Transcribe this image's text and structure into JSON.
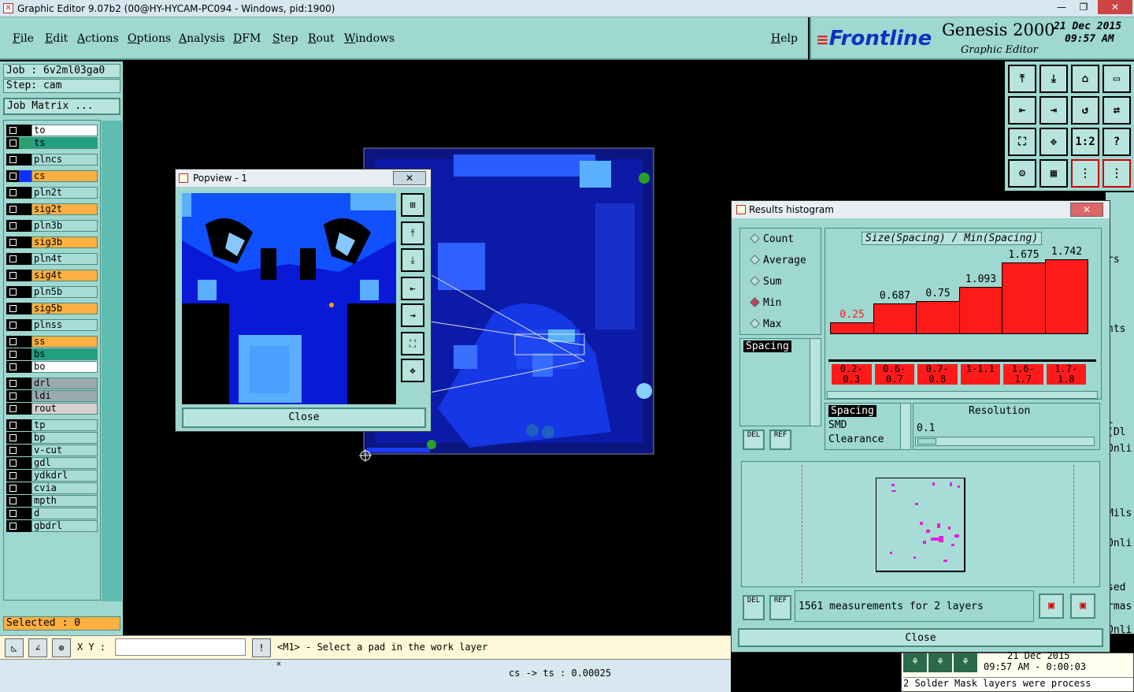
{
  "window": {
    "title": "Graphic Editor 9.07b2 (00@HY-HYCAM-PC094 - Windows, pid:1900)",
    "minimize": "—",
    "restore": "❐",
    "close": "✕"
  },
  "menu": {
    "items": [
      "File",
      "Edit",
      "Actions",
      "Options",
      "Analysis",
      "DFM",
      "Step",
      "Rout",
      "Windows"
    ],
    "help": "Help"
  },
  "brand": {
    "logo": "Frontline",
    "product": "Genesis 2000",
    "subtitle": "Graphic Editor",
    "date": "21 Dec 2015",
    "time": "09:57 AM"
  },
  "left": {
    "job": "Job : 6v2ml03ga0",
    "step": "Step: cam",
    "job_matrix": "Job Matrix ...",
    "selected": "Selected : 0",
    "layers": [
      {
        "name": "to",
        "color": "#000000",
        "bg": "#ffffff"
      },
      {
        "name": "ts",
        "color": "#2aa070",
        "bg": "#20a080",
        "active": true
      },
      {
        "name": "plncs",
        "color": "#000000",
        "bg": "#a8dcd6"
      },
      {
        "name": "cs",
        "color": "#1030ff",
        "bg": "#ffb040"
      },
      {
        "name": "pln2t",
        "color": "#000000",
        "bg": "#a8dcd6"
      },
      {
        "name": "sig2t",
        "color": "#000000",
        "bg": "#ffb040"
      },
      {
        "name": "pln3b",
        "color": "#000000",
        "bg": "#a8dcd6"
      },
      {
        "name": "sig3b",
        "color": "#000000",
        "bg": "#ffb040"
      },
      {
        "name": "pln4t",
        "color": "#000000",
        "bg": "#a8dcd6"
      },
      {
        "name": "sig4t",
        "color": "#000000",
        "bg": "#ffb040"
      },
      {
        "name": "pln5b",
        "color": "#000000",
        "bg": "#a8dcd6"
      },
      {
        "name": "sig5b",
        "color": "#000000",
        "bg": "#ffb040"
      },
      {
        "name": "plnss",
        "color": "#000000",
        "bg": "#a8dcd6"
      },
      {
        "name": "ss",
        "color": "#000000",
        "bg": "#ffb040"
      },
      {
        "name": "bs",
        "color": "#000000",
        "bg": "#20a080"
      },
      {
        "name": "bo",
        "color": "#000000",
        "bg": "#ffffff"
      },
      {
        "name": "drl",
        "color": "#000000",
        "bg": "#9aaab0"
      },
      {
        "name": "ldi",
        "color": "#000000",
        "bg": "#9aaab0"
      },
      {
        "name": "rout",
        "color": "#000000",
        "bg": "#d8d0d0"
      },
      {
        "name": "tp",
        "color": "#000000",
        "bg": "#a8dcd6"
      },
      {
        "name": "bp",
        "color": "#000000",
        "bg": "#a8dcd6"
      },
      {
        "name": "v-cut",
        "color": "#000000",
        "bg": "#a8dcd6"
      },
      {
        "name": "gdl",
        "color": "#000000",
        "bg": "#a8dcd6"
      },
      {
        "name": "ydkdrl",
        "color": "#000000",
        "bg": "#a8dcd6"
      },
      {
        "name": "cvia",
        "color": "#000000",
        "bg": "#a8dcd6"
      },
      {
        "name": "mpth",
        "color": "#000000",
        "bg": "#a8dcd6"
      },
      {
        "name": "d",
        "color": "#000000",
        "bg": "#a8dcd6"
      },
      {
        "name": "gbdrl",
        "color": "#000000",
        "bg": "#a8dcd6"
      }
    ]
  },
  "popview": {
    "title": "Popview - 1",
    "close": "Close",
    "close_x": "✕"
  },
  "histogram": {
    "title": "Results histogram",
    "close_x": "✕",
    "options": [
      "Count",
      "Average",
      "Sum",
      "Min",
      "Max"
    ],
    "selected_option": "Min",
    "chart_title": "Size(Spacing) / Min(Spacing)",
    "list_left": [
      "Spacing"
    ],
    "categories_list": [
      "Spacing",
      "SMD",
      "Clearance"
    ],
    "resolution_label": "Resolution",
    "resolution_value": "0.1",
    "del": "DEL",
    "ref": "REF",
    "measurements": "1561 measurements for 2 layers",
    "close": "Close"
  },
  "chart_data": {
    "type": "bar",
    "title": "Size(Spacing) / Min(Spacing)",
    "categories": [
      "0.2-0.3",
      "0.6-0.7",
      "0.7-0.8",
      "1-1.1",
      "1.6-1.7",
      "1.7-1.8"
    ],
    "values": [
      0.25,
      0.687,
      0.75,
      1.093,
      1.675,
      1.742
    ],
    "ylim": [
      0,
      1.8
    ],
    "colors": {
      "bar": "#ff1a1a",
      "first_label": "#ff1a1a"
    }
  },
  "status": {
    "xy_label": "X Y :",
    "prompt": "<M1> - Select a pad in the work layer",
    "value": "cs -> ts : 0.00025"
  },
  "bottom_right": {
    "date": "21 Dec 2015",
    "time": "09:57 AM - 0:00:03",
    "message": "2 Solder Mask layers were process"
  },
  "behind": {
    "items": [
      "rs",
      "nts",
      "l (Dl",
      "Onli",
      "Mils",
      "Onli",
      "sed",
      "rmas",
      "Onli"
    ]
  }
}
